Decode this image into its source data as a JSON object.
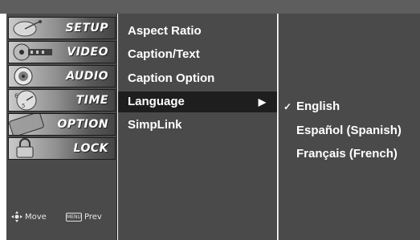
{
  "sidebar": {
    "categories": [
      {
        "label": "SETUP",
        "icon": "satellite-dish-icon"
      },
      {
        "label": "VIDEO",
        "icon": "film-reel-icon"
      },
      {
        "label": "AUDIO",
        "icon": "speaker-icon"
      },
      {
        "label": "TIME",
        "icon": "clock-icon"
      },
      {
        "label": "OPTION",
        "icon": "option-sticker-icon"
      },
      {
        "label": "LOCK",
        "icon": "padlock-icon"
      }
    ],
    "hints": {
      "move_label": "Move",
      "prev_label": "Prev",
      "menu_key_label": "MENU"
    }
  },
  "menu": {
    "items": [
      {
        "label": "Aspect Ratio"
      },
      {
        "label": "Caption/Text"
      },
      {
        "label": "Caption Option"
      },
      {
        "label": "Language",
        "selected": true,
        "has_submenu": true
      },
      {
        "label": "SimpLink"
      }
    ],
    "submenu_arrow": "▶"
  },
  "submenu": {
    "check_glyph": "✓",
    "items": [
      {
        "label": "English",
        "checked": true
      },
      {
        "label": "Español (Spanish)"
      },
      {
        "label": "Français (French)"
      }
    ]
  },
  "colors": {
    "panel": "#4a4a4a",
    "top_bar": "#5e5e5e",
    "highlight": "#1e1e1e",
    "text": "#ffffff"
  }
}
